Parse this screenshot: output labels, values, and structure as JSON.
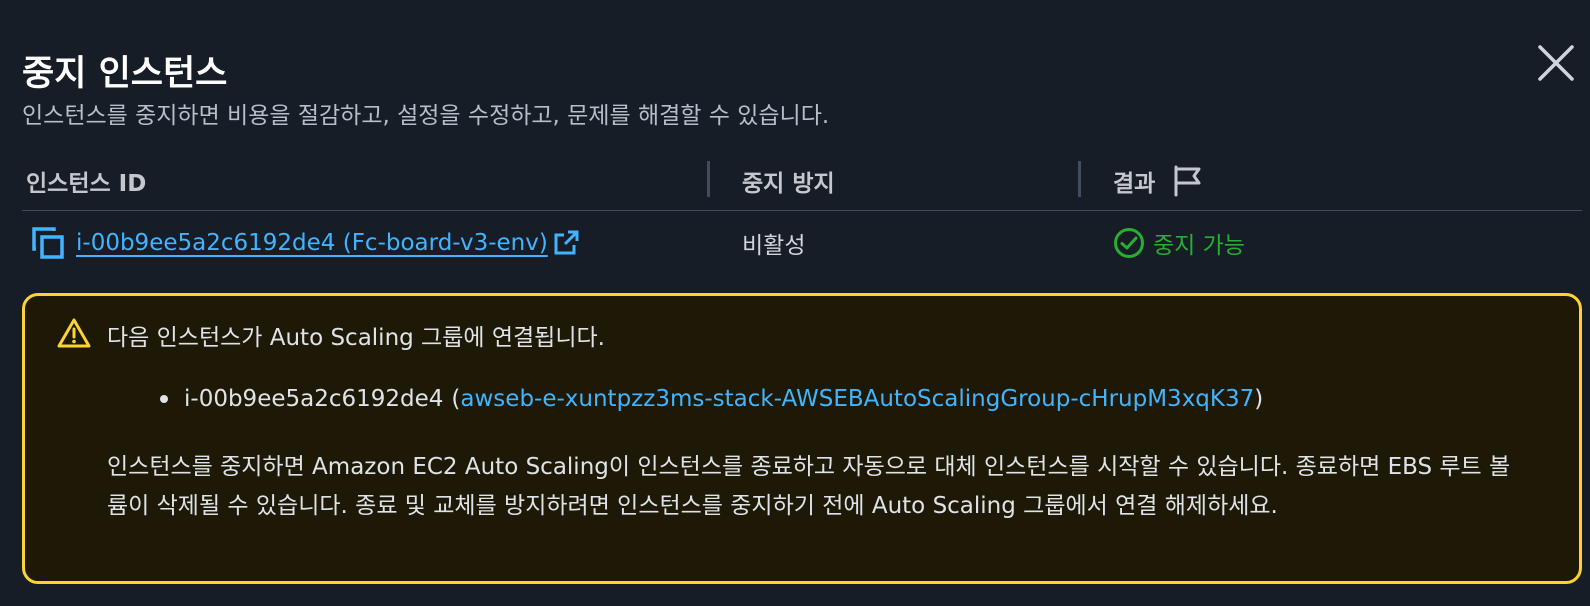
{
  "modal": {
    "title": "중지 인스턴스",
    "subtitle": "인스턴스를 중지하면 비용을 절감하고, 설정을 수정하고, 문제를 해결할 수 있습니다.",
    "close_icon": "close-icon"
  },
  "table": {
    "headers": {
      "instance_id": "인스턴스 ID",
      "stop_protection": "중지 방지",
      "result": "결과"
    },
    "rows": [
      {
        "instance_link": "i-00b9ee5a2c6192de4 (Fc-board-v3-env)",
        "stop_protection": "비활성",
        "result": "중지 가능"
      }
    ]
  },
  "alert": {
    "heading": "다음 인스턴스가 Auto Scaling 그룹에 연결됩니다.",
    "items": [
      {
        "instance": "i-00b9ee5a2c6192de4",
        "open_paren": "(",
        "group": "awseb-e-xuntpzz3ms-stack-AWSEBAutoScalingGroup-cHrupM3xqK37",
        "close_paren": ")"
      }
    ],
    "body": "인스턴스를 중지하면 Amazon EC2 Auto Scaling이 인스턴스를 종료하고 자동으로 대체 인스턴스를 시작할 수 있습니다. 종료하면 EBS 루트 볼륨이 삭제될 수 있습니다. 종료 및 교체를 방지하려면 인스턴스를 중지하기 전에 Auto Scaling 그룹에서 연결 해제하세요."
  },
  "colors": {
    "background": "#161d26",
    "link": "#42b4ff",
    "success": "#29ad32",
    "warning_border": "#fbd332",
    "warning_bg": "#1d1906"
  }
}
